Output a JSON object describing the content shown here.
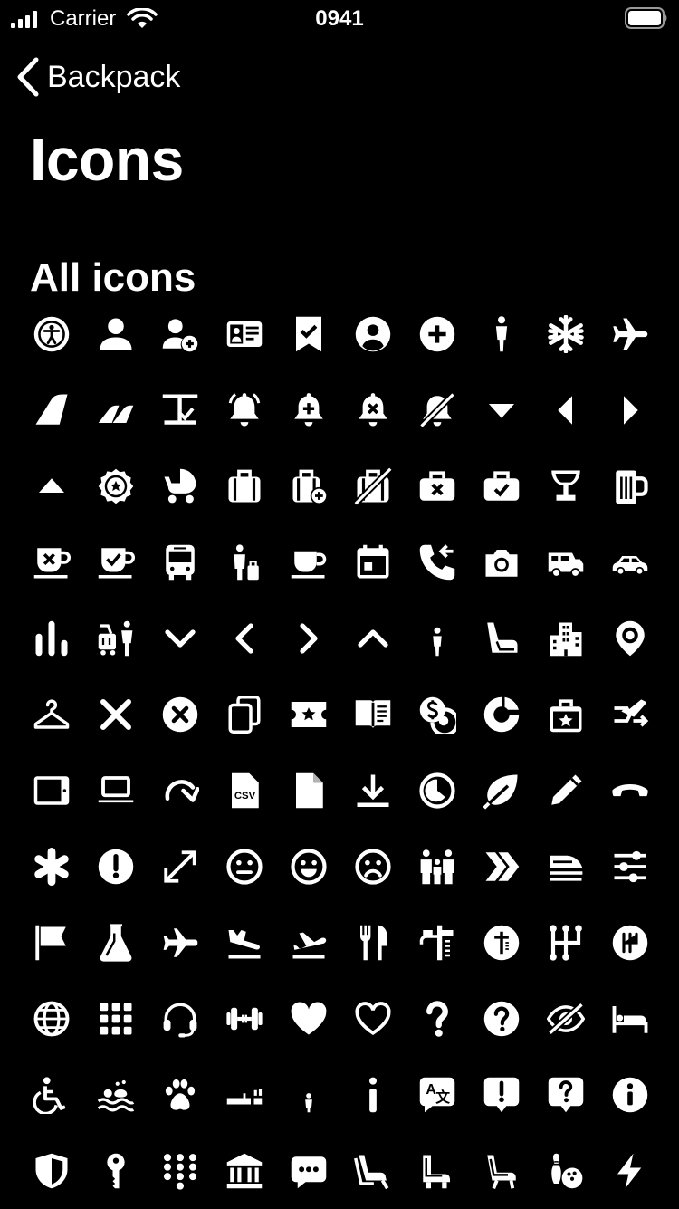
{
  "status_bar": {
    "carrier": "Carrier",
    "time": "0941"
  },
  "nav": {
    "back_label": "Backpack"
  },
  "page": {
    "title": "Icons",
    "section_title": "All icons"
  },
  "icons": [
    [
      "accessibility",
      "account",
      "account-add",
      "account-id-card",
      "bookmark-checked",
      "account-circle",
      "add-circle",
      "adult",
      "air-con",
      "aircraft"
    ],
    [
      "airline",
      "airline-multiple",
      "airport-security",
      "alert",
      "alert-add",
      "alert-remove",
      "alert-off",
      "arrow-down",
      "arrow-left",
      "arrow-right"
    ],
    [
      "arrow-up",
      "award",
      "baby-carriage",
      "baggage",
      "baggage-add",
      "baggage-off",
      "baggage-remove",
      "baggage-checked",
      "bar",
      "beer"
    ],
    [
      "beverage-remove",
      "beverage-checked",
      "bus",
      "business",
      "cafe",
      "calendar",
      "call-back",
      "camera",
      "camper-van",
      "car"
    ],
    [
      "charts",
      "checked-baggage",
      "chevron-down",
      "chevron-left",
      "chevron-right",
      "chevron-up",
      "child",
      "child-seat",
      "city",
      "city-center"
    ],
    [
      "cloakroom",
      "close",
      "close-circle",
      "copy",
      "coupon",
      "credit",
      "currency",
      "data",
      "deals",
      "direct-flight"
    ],
    [
      "tablet",
      "laptop",
      "redo",
      "csv-file",
      "document",
      "download",
      "duration",
      "eco-leaf",
      "edit",
      "end-call"
    ],
    [
      "asterisk",
      "exclamation-circle",
      "expand",
      "face-neutral",
      "face-happy",
      "face-sad",
      "family",
      "fast-track",
      "fast-train",
      "filter"
    ],
    [
      "flag",
      "flask",
      "flight",
      "flight-landing",
      "flight-takeoff",
      "food",
      "fuel",
      "fuel-circle",
      "gears",
      "gears-circle"
    ],
    [
      "globe",
      "grid",
      "headset",
      "gym",
      "heart",
      "heart-outline",
      "help",
      "help-circle",
      "hide",
      "hotels"
    ],
    [
      "wheelchair",
      "hot-springs",
      "pet",
      "no-smoking",
      "infant",
      "information",
      "language",
      "message-alert",
      "message-help",
      "information-circle"
    ],
    [
      "insurance",
      "key",
      "keypad",
      "landmark",
      "chat",
      "lounge",
      "lounge-seat",
      "lounge-recline",
      "bowling",
      "lightning"
    ]
  ]
}
